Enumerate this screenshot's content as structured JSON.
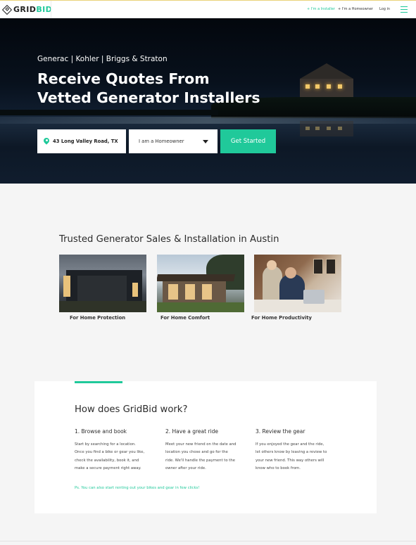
{
  "brand": {
    "logo_prefix": "GRID",
    "logo_suffix": "BID",
    "accent_color": "#20c99a"
  },
  "nav": {
    "installer_label": "+ I'm a Installer",
    "homeowner_label": "+ I'm a Homeowner",
    "login_label": "Log in",
    "menu_icon": "hamburger-menu-icon"
  },
  "hero": {
    "brands": "Generac | Kohler | Briggs & Straton",
    "title_line1": "Receive Quotes From",
    "title_line2": "Vetted Generator Installers",
    "location_value": "43 Long Valley Road, TX",
    "location_icon": "map-pin-icon",
    "role_selected": "I am a Homeowner",
    "cta_label": "Get Started"
  },
  "trusted": {
    "title": "Trusted Generator Sales & Installation in Austin",
    "cards": [
      {
        "label": "For Home Protection"
      },
      {
        "label": "For Home Comfort"
      },
      {
        "label": "For Home Productivity"
      }
    ]
  },
  "how": {
    "title": "How does GridBid work?",
    "steps": [
      {
        "title": "1. Browse and book",
        "lines": [
          "Start by searching for a location.",
          "Once you find a bike or gear you like,",
          "check the availability, book it, and",
          "make a secure payment right away."
        ]
      },
      {
        "title": "2. Have a great ride",
        "lines": [
          "Meet your new friend on the date and",
          "location you chose and go for the",
          "ride. We'll handle the payment to the",
          "owner after your ride."
        ]
      },
      {
        "title": "3. Review the gear",
        "lines": [
          "If you enjoyed the gear and the ride,",
          "let others know by leaving a review to",
          "your new friend. This way others will",
          "know who to book from."
        ]
      }
    ],
    "ps_note": "Ps. You can also start renting out your bikes and gear in few clicks!"
  }
}
